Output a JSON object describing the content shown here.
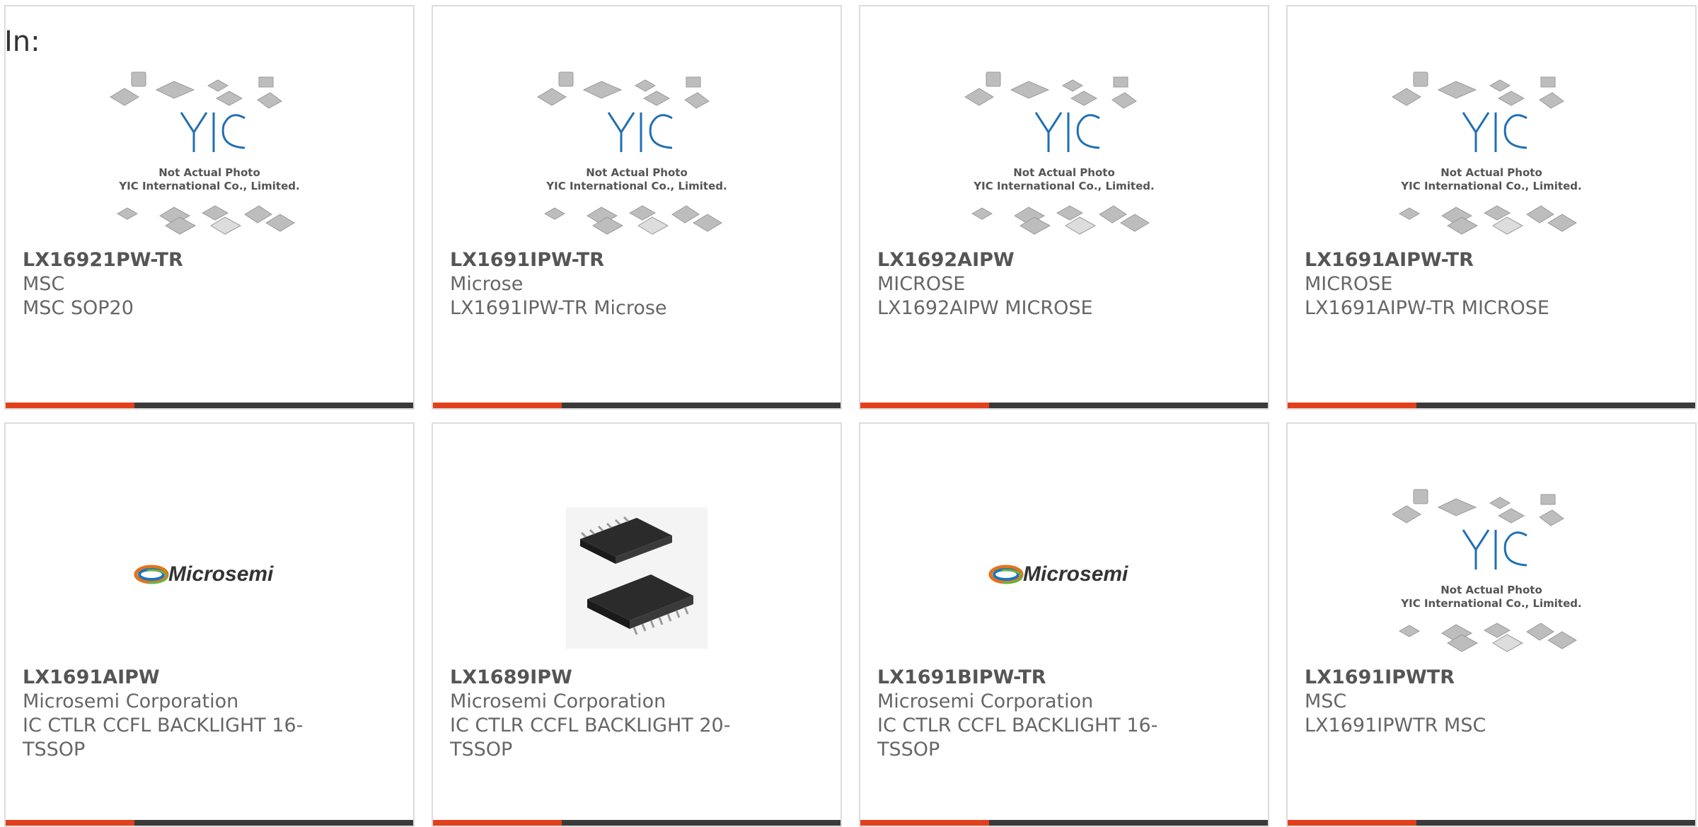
{
  "prefix_label": "In:",
  "placeholder": {
    "caption_line1": "Not Actual Photo",
    "caption_line2": "YIC International Co., Limited.",
    "logo_text": "YIC"
  },
  "brand_logo_text": "Microsemi",
  "colors": {
    "accent": "#e2401c",
    "bar": "#3a3a3a",
    "border": "#dcdcdc"
  },
  "products": [
    {
      "part": "LX16921PW-TR",
      "maker": "MSC",
      "desc": "MSC SOP20",
      "image": "placeholder"
    },
    {
      "part": "LX1691IPW-TR",
      "maker": "Microse",
      "desc": "LX1691IPW-TR Microse",
      "image": "placeholder"
    },
    {
      "part": "LX1692AIPW",
      "maker": "MICROSE",
      "desc": "LX1692AIPW MICROSE",
      "image": "placeholder"
    },
    {
      "part": "LX1691AIPW-TR",
      "maker": "MICROSE",
      "desc": "LX1691AIPW-TR MICROSE",
      "image": "placeholder"
    },
    {
      "part": "LX1691AIPW",
      "maker": "Microsemi Corporation",
      "desc": "IC CTLR CCFL BACKLIGHT 16-TSSOP",
      "image": "microsemi-logo"
    },
    {
      "part": "LX1689IPW",
      "maker": "Microsemi Corporation",
      "desc": "IC CTLR CCFL BACKLIGHT 20-TSSOP",
      "image": "tssop-chip-photo"
    },
    {
      "part": "LX1691BIPW-TR",
      "maker": "Microsemi Corporation",
      "desc": "IC CTLR CCFL BACKLIGHT 16-TSSOP",
      "image": "microsemi-logo"
    },
    {
      "part": "LX1691IPWTR",
      "maker": "MSC",
      "desc": "LX1691IPWTR MSC",
      "image": "placeholder"
    }
  ]
}
